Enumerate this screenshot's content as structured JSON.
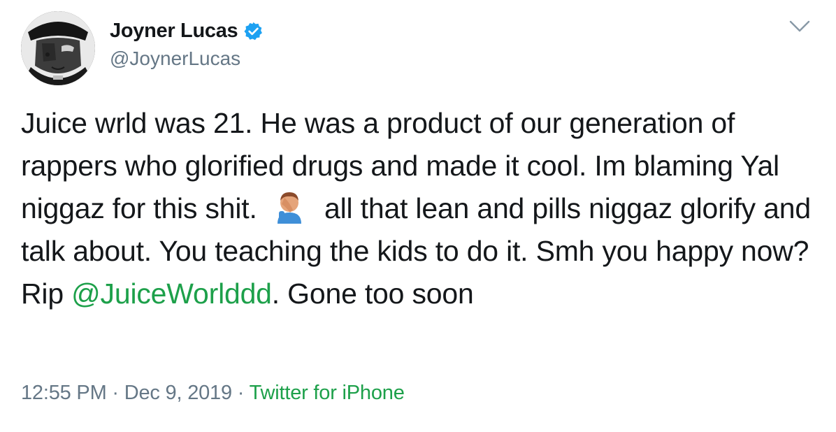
{
  "author": {
    "display_name": "Joyner Lucas",
    "handle": "@JoynerLucas",
    "avatar_icon": "profile-photo",
    "verified": true,
    "verified_color": "#1da1f2"
  },
  "tweet": {
    "segment1": "Juice wrld was 21. He was a product of our generation of rappers who glorified drugs and made it cool. Im blaming Yal niggaz for this shit.",
    "emoji": "man-facepalming-emoji",
    "segment2": "all that lean and pills niggaz glorify and talk about. You teaching the kids to do it. Smh you happy now?Rip",
    "mention": "@JuiceWorlddd",
    "segment3": ". Gone too soon"
  },
  "meta": {
    "time": "12:55 PM",
    "separator": "·",
    "date": "Dec 9, 2019",
    "source": "Twitter for iPhone"
  },
  "colors": {
    "link": "#1da04a",
    "secondary_text": "#657786",
    "primary_text": "#14171a"
  },
  "menu": {
    "icon": "chevron-down-icon"
  }
}
